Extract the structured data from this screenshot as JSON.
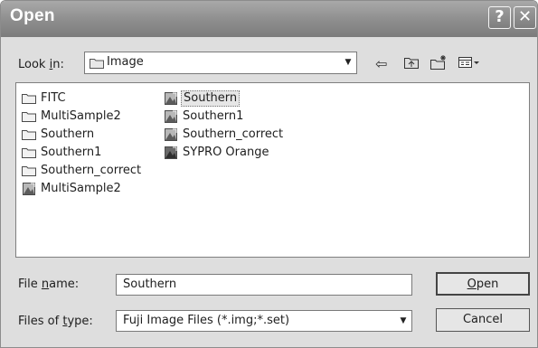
{
  "window": {
    "title": "Open",
    "help_glyph": "?",
    "close_glyph": "✕"
  },
  "lookin": {
    "label_before": "Look ",
    "label_accel": "i",
    "label_after": "n:",
    "value": "Image",
    "folder_icon": "folder-icon"
  },
  "toolbar": {
    "back": "⇦",
    "up": "⮤",
    "newfolder": "✱",
    "views": "▦▾"
  },
  "files": [
    {
      "name": "FITC",
      "type": "folder"
    },
    {
      "name": "MultiSample2",
      "type": "folder"
    },
    {
      "name": "Southern",
      "type": "folder"
    },
    {
      "name": "Southern1",
      "type": "folder"
    },
    {
      "name": "Southern_correct",
      "type": "folder"
    },
    {
      "name": "MultiSample2",
      "type": "image"
    },
    {
      "name": "Southern",
      "type": "image",
      "selected": true
    },
    {
      "name": "Southern1",
      "type": "image"
    },
    {
      "name": "Southern_correct",
      "type": "image"
    },
    {
      "name": "SYPRO Orange",
      "type": "image-dark"
    }
  ],
  "filename": {
    "label_before": "File ",
    "label_accel": "n",
    "label_after": "ame:",
    "value": "Southern"
  },
  "filetype": {
    "label_before": "Files of ",
    "label_accel": "t",
    "label_after": "ype:",
    "value": "Fuji Image Files (*.img;*.set)"
  },
  "buttons": {
    "open_accel": "O",
    "open_rest": "pen",
    "cancel": "Cancel"
  }
}
